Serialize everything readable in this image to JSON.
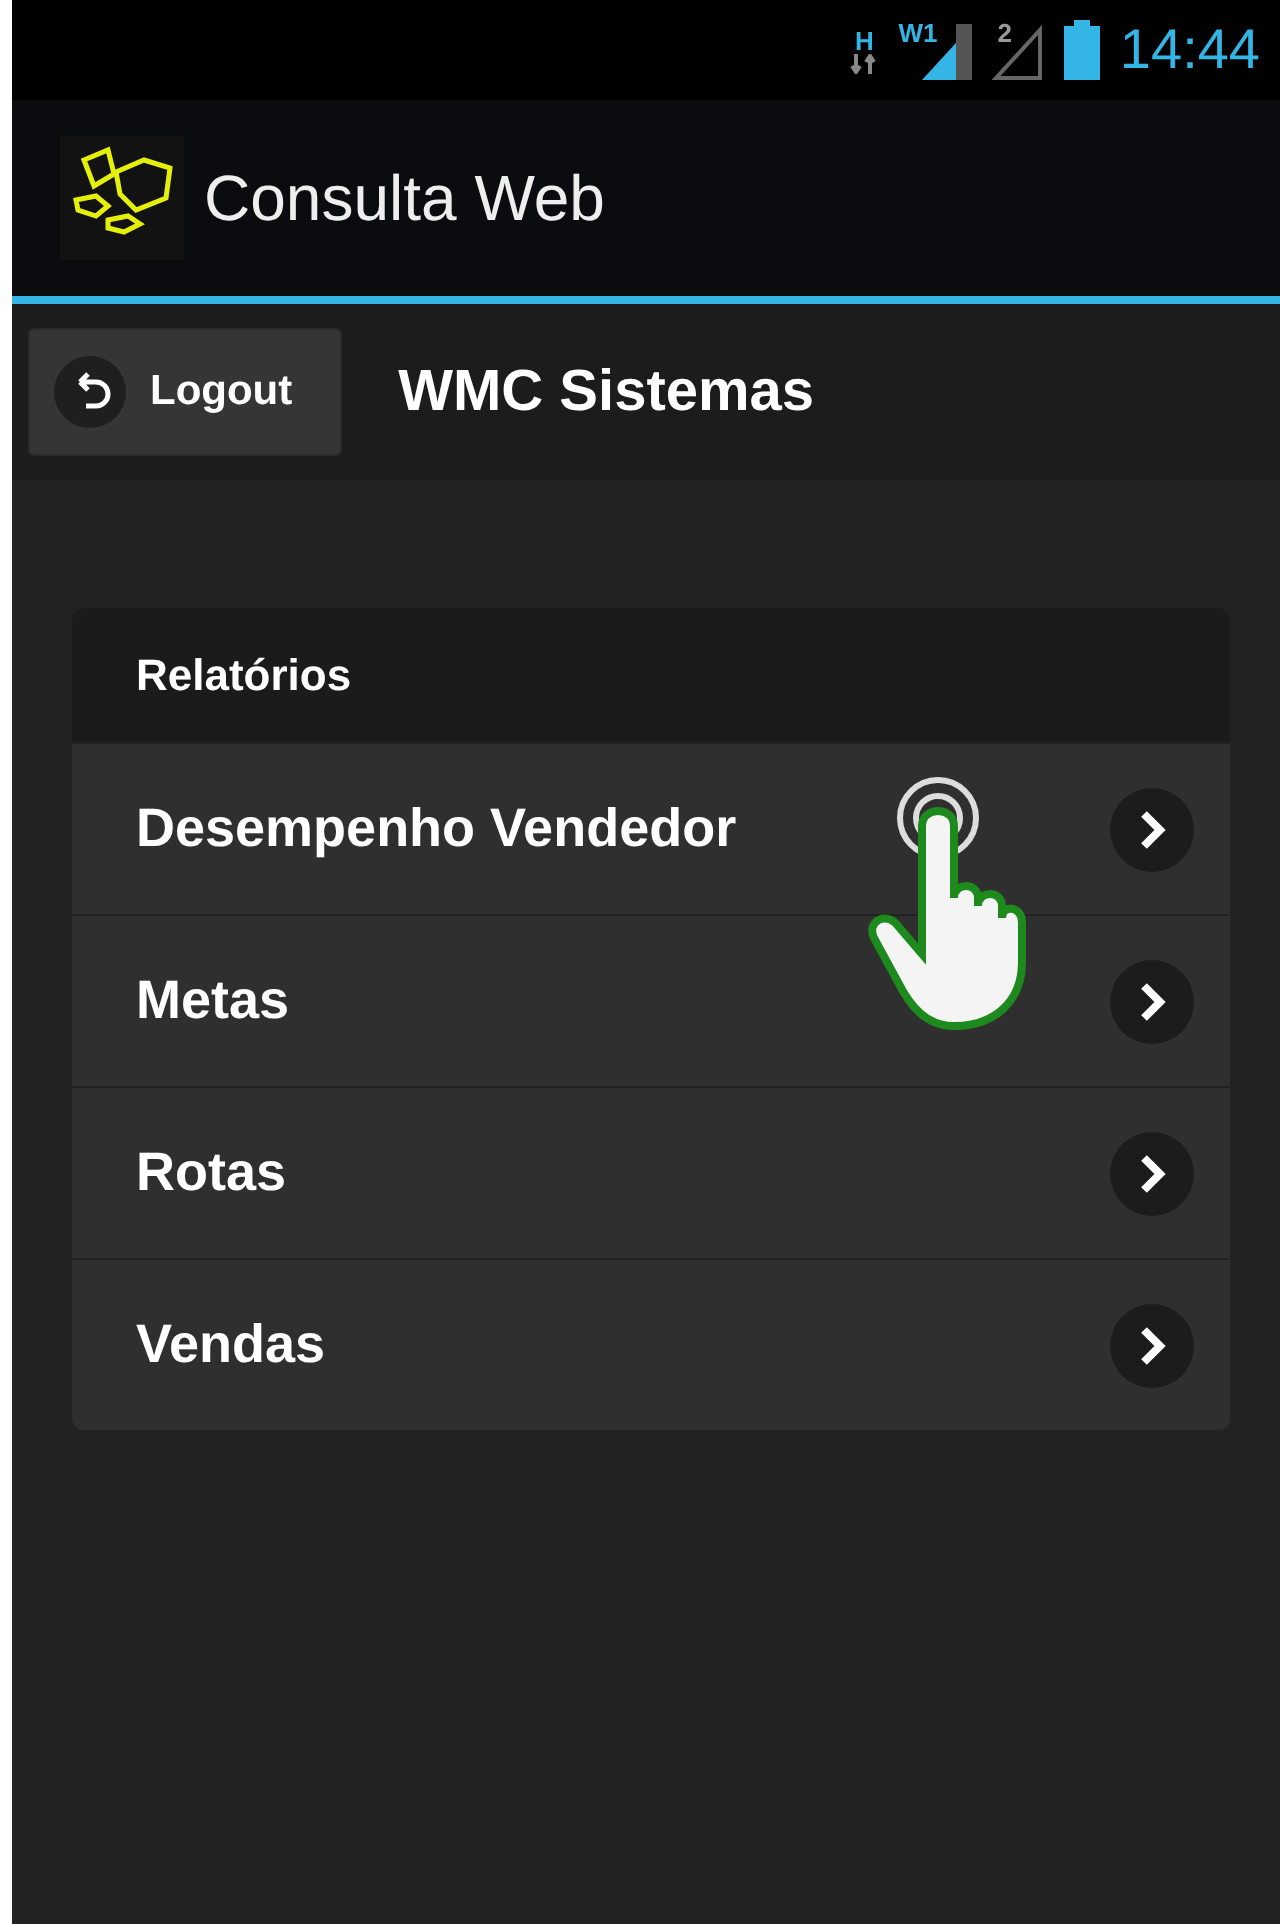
{
  "status_bar": {
    "network_type": "H",
    "sim1_label": "W1",
    "sim2_label": "2",
    "time": "14:44"
  },
  "action_bar": {
    "title": "Consulta Web"
  },
  "toolbar": {
    "logout_button": "Logout",
    "title": "WMC Sistemas"
  },
  "list": {
    "header": "Relatórios",
    "items": [
      {
        "label": "Desempenho Vendedor",
        "touched": true
      },
      {
        "label": "Metas",
        "touched": false
      },
      {
        "label": "Rotas",
        "touched": false
      },
      {
        "label": "Vendas",
        "touched": false
      }
    ]
  }
}
